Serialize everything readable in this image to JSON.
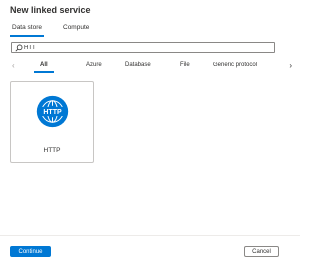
{
  "dialog": {
    "title": "New linked service"
  },
  "tabs": [
    {
      "label": "Data store",
      "active": true
    },
    {
      "label": "Compute",
      "active": false
    }
  ],
  "search": {
    "value": "HTT",
    "icon": "search-icon"
  },
  "filters": {
    "items": [
      "All",
      "Azure",
      "Database",
      "File",
      "Generic protocol"
    ],
    "selected": "All",
    "prev_icon": "chevron-left-icon",
    "next_icon": "chevron-right-icon"
  },
  "results": [
    {
      "label": "HTTP",
      "logo_text": "HTTP",
      "icon": "globe-icon"
    }
  ],
  "footer": {
    "continue_label": "Continue",
    "cancel_label": "Cancel"
  },
  "colors": {
    "accent": "#0078d4",
    "text": "#323130",
    "border": "#c8c6c4"
  }
}
